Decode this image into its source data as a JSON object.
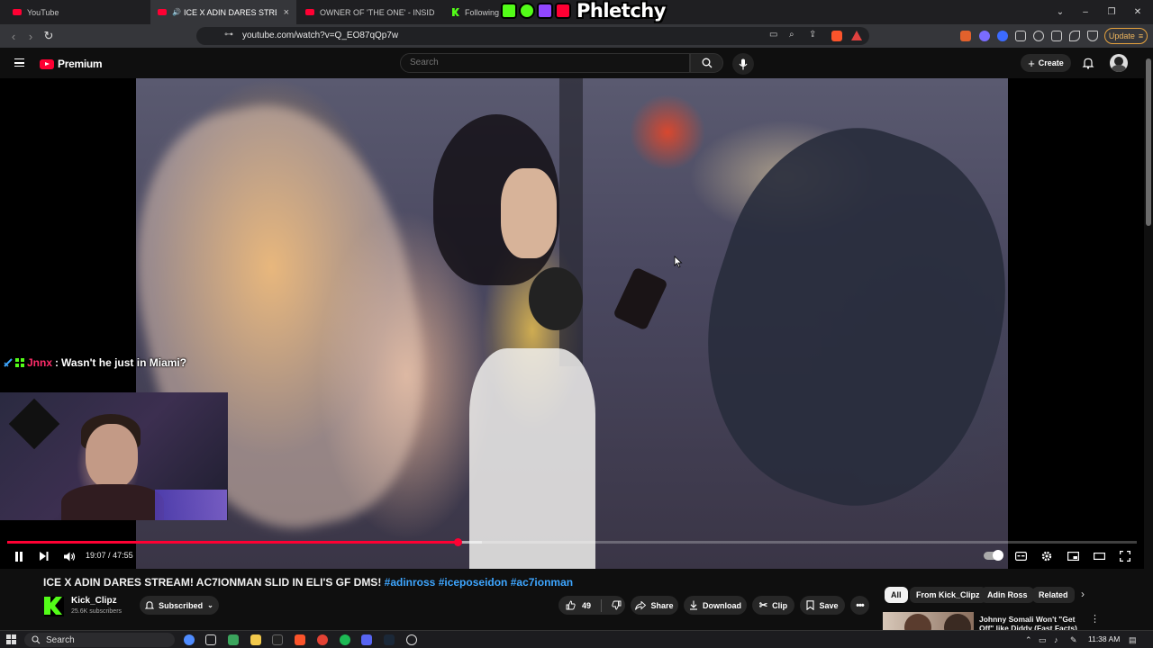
{
  "browser": {
    "tabs": [
      {
        "label": "YouTube",
        "active": false
      },
      {
        "label": "ICE X ADIN DARES STREAM! A",
        "active": true
      },
      {
        "label": "OWNER OF 'THE ONE' - INSIDE HIS S",
        "active": false
      },
      {
        "label": "Following",
        "active": false
      }
    ],
    "url": "youtube.com/watch?v=Q_EO87qQp7w",
    "update_label": "Update"
  },
  "overlay": {
    "logo_text": "Phletchy",
    "logo_colors": [
      "#53fc18",
      "#53fc18",
      "#9146ff",
      "#ff0033"
    ]
  },
  "masthead": {
    "brand": "Premium",
    "search_placeholder": "Search",
    "create_label": "Create"
  },
  "player": {
    "chat": {
      "user": "Jnnx",
      "sep": ":",
      "message": "Wasn't he just in Miami?"
    },
    "time_current": "19:07",
    "time_sep": "/",
    "time_total": "47:55",
    "progress_fraction": 0.399,
    "buffer_fraction": 0.42
  },
  "video": {
    "title": "ICE X ADIN DARES STREAM! AC7IONMAN SLID IN ELI'S GF DMS!",
    "hashtags": [
      "#adinross",
      "#iceposeidon",
      "#ac7ionman"
    ],
    "channel": {
      "name": "Kick_Clipz",
      "subs": "25.6K subscribers"
    },
    "subscribed_label": "Subscribed",
    "likes": "49",
    "actions": {
      "share": "Share",
      "download": "Download",
      "clip": "Clip",
      "save": "Save"
    }
  },
  "related": {
    "chips": [
      "All",
      "From Kick_Clipz",
      "Adin Ross",
      "Related"
    ],
    "first_title": "Johnny Somali Won't \"Get Off\" like Diddy (Fast Facts)"
  },
  "taskbar": {
    "search_label": "Search",
    "time": "11:38 AM"
  }
}
